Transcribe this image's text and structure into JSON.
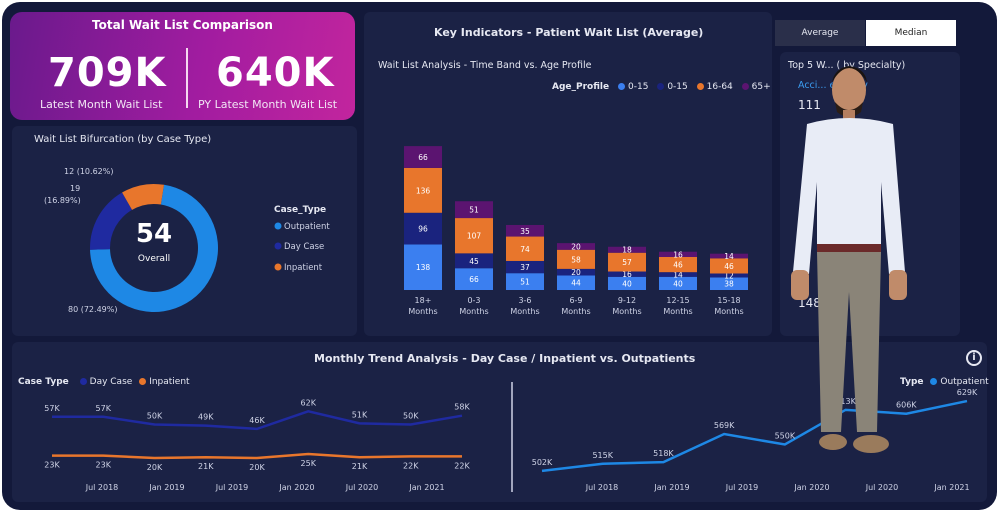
{
  "kpi": {
    "title": "Total Wait List Comparison",
    "latest_value": "709K",
    "latest_label": "Latest Month Wait List",
    "py_value": "640K",
    "py_label": "PY Latest Month Wait List"
  },
  "toggle": {
    "average": "Average",
    "median": "Median"
  },
  "key_indicators_title": "Key Indicators - Patient Wait List (Average)",
  "colors": {
    "outpatient": "#1e88e5",
    "day_case": "#1f2aa0",
    "inpatient": "#e8762c",
    "age65": "#5b1470",
    "age0_15": "#3b7ff0",
    "age0_15b": "#1a237e"
  },
  "donut": {
    "title": "Wait List Bifurcation (by Case Type)",
    "center_value": "54",
    "center_label": "Overall",
    "labels": [
      "12 (10.62%)",
      "19 (16.89%)",
      "80 (72.49%)"
    ],
    "legend_title": "Case_Type",
    "legend": [
      "Outpatient",
      "Day Case",
      "Inpatient"
    ]
  },
  "bar_chart": {
    "subtitle": "Wait List Analysis - Time Band vs. Age Profile",
    "legend_title": "Age_Profile",
    "legend": [
      "0-15",
      "0-15",
      "16-64",
      "65+"
    ]
  },
  "top5": {
    "title": "Top 5 W... ( by Specialty)",
    "item1": "Acci... ergency",
    "value1": "111",
    "value2": "148"
  },
  "trend": {
    "title": "Monthly Trend Analysis - Day Case / Inpatient vs. Outpatients",
    "left_legend_title": "Case Type",
    "left_legend": [
      "Day Case",
      "Inpatient"
    ],
    "right_legend_title": "Type",
    "right_legend": [
      "Outpatient"
    ],
    "info_icon": "info-icon"
  },
  "chart_data": [
    {
      "type": "pie",
      "categories": [
        "Outpatient",
        "Day Case",
        "Inpatient"
      ],
      "values": [
        80,
        19,
        12
      ],
      "title": "Wait List Bifurcation (by Case Type)"
    },
    {
      "type": "bar",
      "title": "Wait List Analysis - Time Band vs. Age Profile",
      "categories": [
        "18+ Months",
        "0-3 Months",
        "3-6 Months",
        "6-9 Months",
        "9-12 Months",
        "12-15 Months",
        "15-18 Months"
      ],
      "series": [
        {
          "name": "0-15",
          "values": [
            138,
            66,
            51,
            44,
            40,
            40,
            38
          ]
        },
        {
          "name": "0-15",
          "values": [
            96,
            45,
            37,
            20,
            16,
            14,
            12
          ]
        },
        {
          "name": "16-64",
          "values": [
            136,
            107,
            74,
            58,
            57,
            46,
            46
          ]
        },
        {
          "name": "65+",
          "values": [
            66,
            51,
            35,
            20,
            18,
            16,
            14
          ]
        }
      ]
    },
    {
      "type": "line",
      "x_ticks": [
        "Jul 2018",
        "Jan 2019",
        "Jul 2019",
        "Jan 2020",
        "Jul 2020",
        "Jan 2021"
      ],
      "series": [
        {
          "name": "Day Case",
          "values": [
            57,
            57,
            50,
            49,
            46,
            62,
            51,
            50,
            58
          ]
        },
        {
          "name": "Inpatient",
          "values": [
            23,
            23,
            20,
            21,
            20,
            25,
            21,
            22,
            22
          ]
        }
      ],
      "point_labels_daycase": [
        "57K",
        "57K",
        "50K",
        "49K",
        "46K",
        "62K",
        "51K",
        "50K",
        "58K"
      ],
      "point_labels_inpatient": [
        "23K",
        "23K",
        "20K",
        "21K",
        "20K",
        "25K",
        "21K",
        "22K",
        "22K"
      ]
    },
    {
      "type": "line",
      "x_ticks": [
        "Jul 2018",
        "Jan 2019",
        "Jul 2019",
        "Jan 2020",
        "Jul 2020",
        "Jan 2021"
      ],
      "series": [
        {
          "name": "Outpatient",
          "values": [
            502,
            515,
            518,
            569,
            550,
            613,
            606,
            629
          ]
        }
      ],
      "point_labels": [
        "502K",
        "515K",
        "518K",
        "569K",
        "550K",
        "613K",
        "606K",
        "629K"
      ]
    }
  ]
}
